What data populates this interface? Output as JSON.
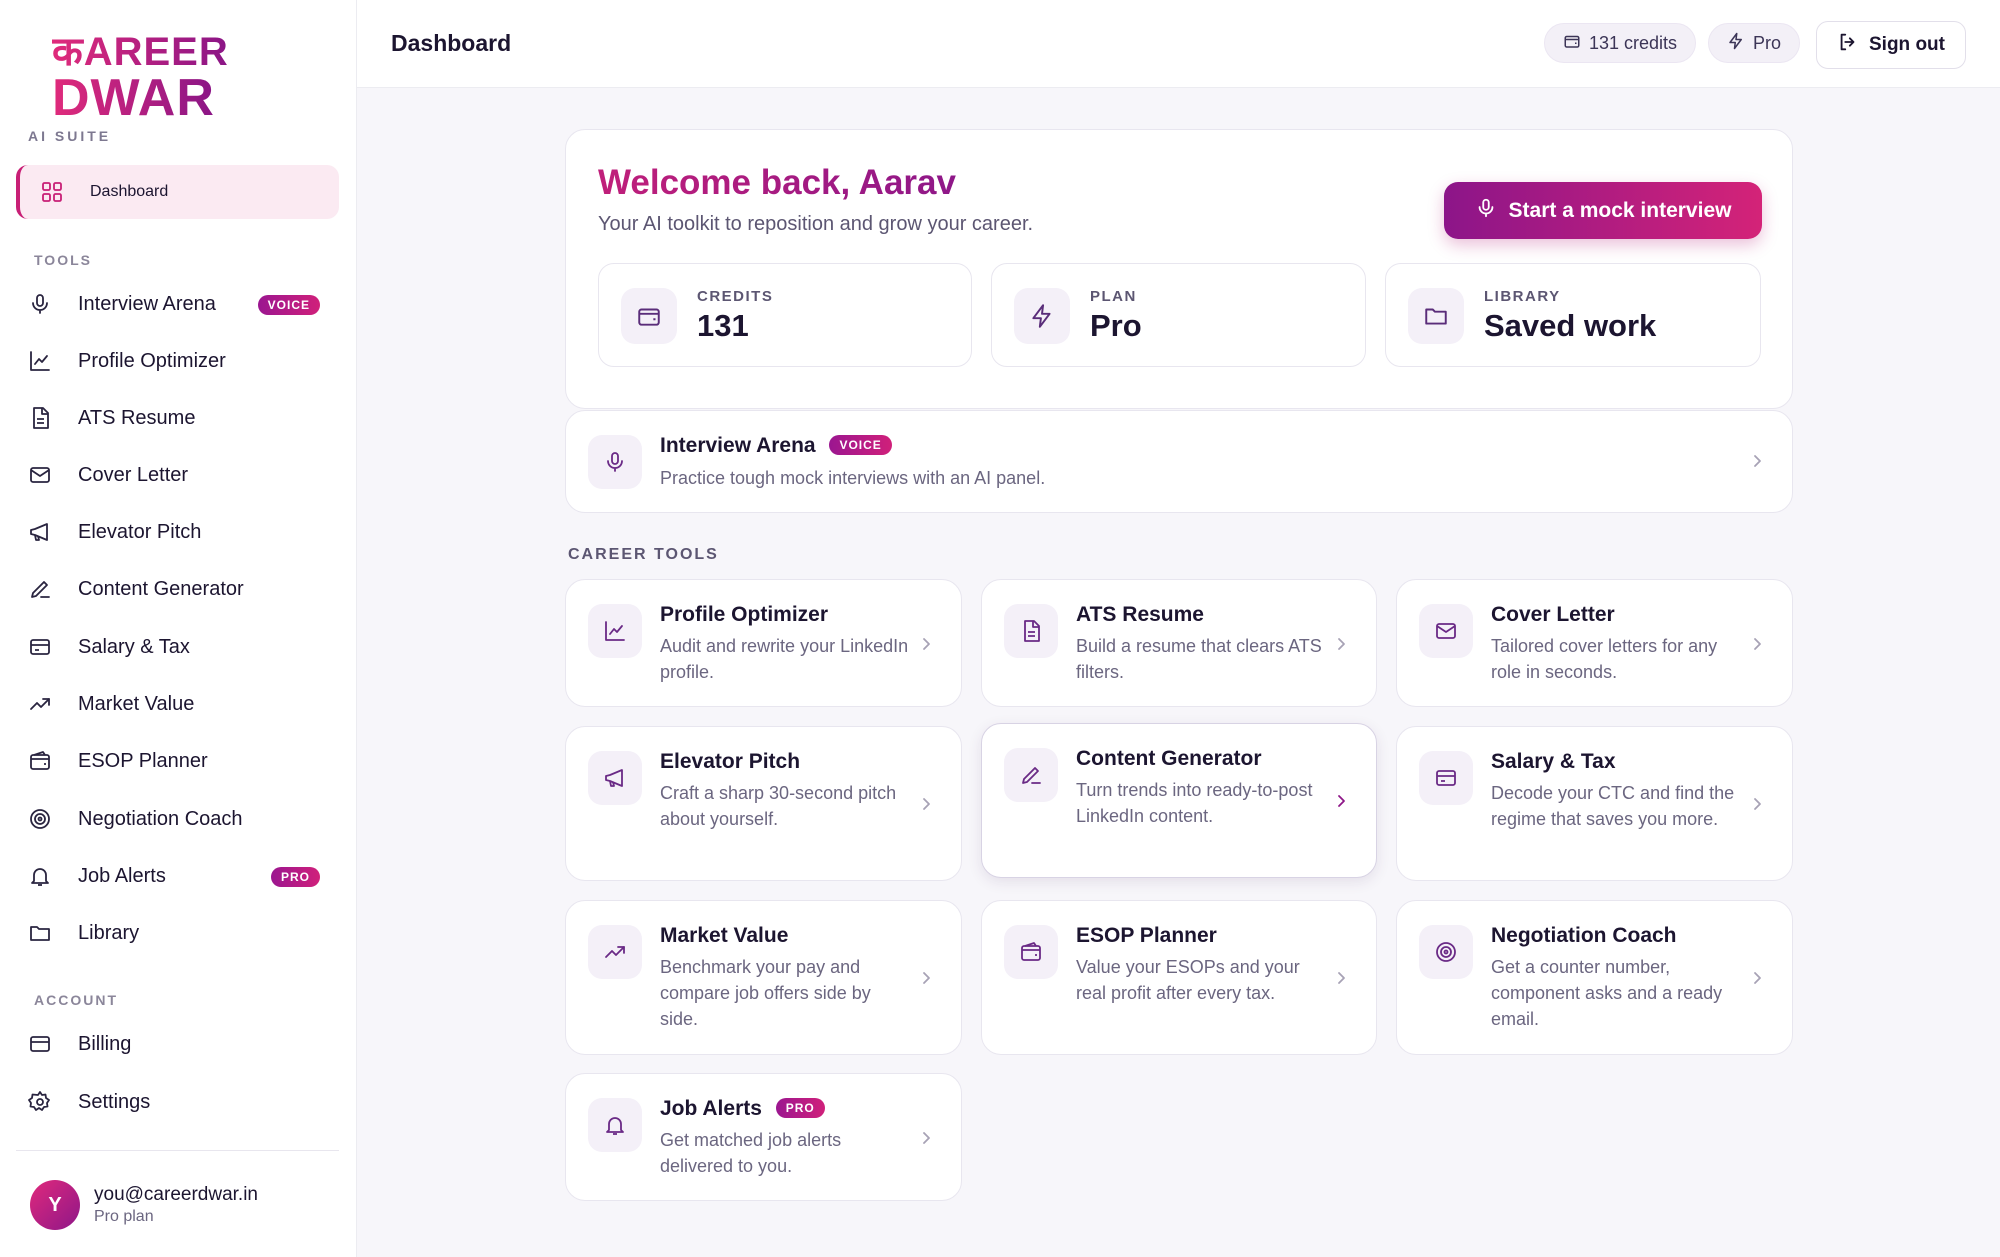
{
  "brand": {
    "logo_line1": "कAREER",
    "logo_line2": "DWAR",
    "subtitle": "AI SUITE"
  },
  "sidebar": {
    "active": {
      "label": "Dashboard",
      "icon": "grid-icon"
    },
    "tools_heading": "TOOLS",
    "tools": [
      {
        "label": "Interview Arena",
        "icon": "mic-icon",
        "tag": "VOICE"
      },
      {
        "label": "Profile Optimizer",
        "icon": "chart-line-icon"
      },
      {
        "label": "ATS Resume",
        "icon": "document-icon"
      },
      {
        "label": "Cover Letter",
        "icon": "mail-icon"
      },
      {
        "label": "Elevator Pitch",
        "icon": "megaphone-icon"
      },
      {
        "label": "Content Generator",
        "icon": "pen-icon"
      },
      {
        "label": "Salary & Tax",
        "icon": "card-icon"
      },
      {
        "label": "Market Value",
        "icon": "trending-up-icon"
      },
      {
        "label": "ESOP Planner",
        "icon": "wallet-icon"
      },
      {
        "label": "Negotiation Coach",
        "icon": "target-icon"
      },
      {
        "label": "Job Alerts",
        "icon": "bell-icon",
        "tag": "PRO"
      },
      {
        "label": "Library",
        "icon": "folder-icon"
      }
    ],
    "account_heading": "ACCOUNT",
    "account": [
      {
        "label": "Billing",
        "icon": "card-icon"
      },
      {
        "label": "Settings",
        "icon": "gear-icon"
      }
    ],
    "user": {
      "initial": "Y",
      "email": "you@careerdwar.in",
      "plan": "Pro plan"
    }
  },
  "header": {
    "title": "Dashboard",
    "credits_pill": "131 credits",
    "plan_pill": "Pro",
    "signout": "Sign out"
  },
  "welcome": {
    "title": "Welcome back, Aarav",
    "subtitle": "Your AI toolkit to reposition and grow your career.",
    "cta": "Start a mock interview",
    "stats": [
      {
        "label": "CREDITS",
        "value": "131",
        "icon": "wallet-icon"
      },
      {
        "label": "PLAN",
        "value": "Pro",
        "icon": "bolt-icon"
      },
      {
        "label": "LIBRARY",
        "value": "Saved work",
        "icon": "folder-icon"
      }
    ]
  },
  "arena": {
    "title": "Interview Arena",
    "tag": "VOICE",
    "desc": "Practice tough mock interviews with an AI panel."
  },
  "career_tools": {
    "heading": "CAREER TOOLS",
    "items": [
      {
        "title": "Profile Optimizer",
        "desc": "Audit and rewrite your LinkedIn profile.",
        "icon": "chart-line-icon"
      },
      {
        "title": "ATS Resume",
        "desc": "Build a resume that clears ATS filters.",
        "icon": "document-icon"
      },
      {
        "title": "Cover Letter",
        "desc": "Tailored cover letters for any role in seconds.",
        "icon": "mail-icon"
      },
      {
        "title": "Elevator Pitch",
        "desc": "Craft a sharp 30-second pitch about yourself.",
        "icon": "megaphone-icon"
      },
      {
        "title": "Content Generator",
        "desc": "Turn trends into ready-to-post LinkedIn content.",
        "icon": "pen-icon"
      },
      {
        "title": "Salary & Tax",
        "desc": "Decode your CTC and find the regime that saves you more.",
        "icon": "card-icon"
      },
      {
        "title": "Market Value",
        "desc": "Benchmark your pay and compare job offers side by side.",
        "icon": "trending-up-icon"
      },
      {
        "title": "ESOP Planner",
        "desc": "Value your ESOPs and your real profit after every tax.",
        "icon": "wallet-icon"
      },
      {
        "title": "Negotiation Coach",
        "desc": "Get a counter number, component asks and a ready email.",
        "icon": "target-icon"
      },
      {
        "title": "Job Alerts",
        "desc": "Get matched job alerts delivered to you.",
        "icon": "bell-icon",
        "tag": "PRO"
      }
    ]
  }
}
